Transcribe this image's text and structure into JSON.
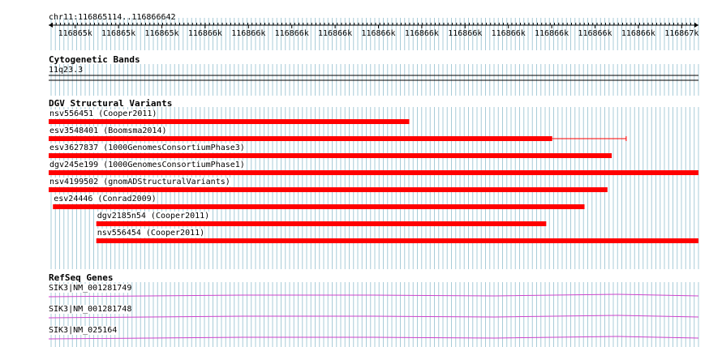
{
  "ruler": {
    "locus": "chr11:116865114..116866642",
    "tick_labels": [
      "116865k",
      "116865k",
      "116865k",
      "116866k",
      "116866k",
      "116866k",
      "116866k",
      "116866k",
      "116866k",
      "116866k",
      "116866k",
      "116866k",
      "116866k",
      "116866k",
      "116867k"
    ]
  },
  "tracks": {
    "cytoband": {
      "title": "Cytogenetic Bands",
      "band": "11q23.3"
    },
    "dgv": {
      "title": "DGV Structural Variants",
      "features": [
        {
          "label": "nsv556451 (Cooper2011)",
          "start": 116865114,
          "end": 116865962,
          "color": "#ff0000"
        },
        {
          "label": "esv3548401 (Boomsma2014)",
          "start": 116865114,
          "end": 116866298,
          "extends_to": 116866472,
          "color": "#ff0000"
        },
        {
          "label": "esv3627837 (1000GenomesConsortiumPhase3)",
          "start": 116865114,
          "end": 116866438,
          "color": "#ff0000"
        },
        {
          "label": "dgv245e199 (1000GenomesConsortiumPhase1)",
          "start": 116865114,
          "end": 116866642,
          "color": "#ff0000"
        },
        {
          "label": "nsv4199502 (gnomADStructuralVariants)",
          "start": 116865114,
          "end": 116866428,
          "color": "#ff0000"
        },
        {
          "label": "esv24446 (Conrad2009)",
          "start": 116865124,
          "end": 116866374,
          "color": "#ff0000"
        },
        {
          "label": "dgv2185n54 (Cooper2011)",
          "start": 116865226,
          "end": 116866284,
          "color": "#ff0000"
        },
        {
          "label": "nsv556454 (Cooper2011)",
          "start": 116865226,
          "end": 116866642,
          "color": "#ff0000"
        }
      ]
    },
    "refseq": {
      "title": "RefSeq Genes",
      "genes": [
        {
          "label": "SIK3|NM_001281749",
          "color": "#cc44cc"
        },
        {
          "label": "SIK3|NM_001281748",
          "color": "#cc44cc"
        },
        {
          "label": "SIK3|NM_025164",
          "color": "#cc44cc"
        }
      ]
    }
  },
  "colors": {
    "grid": "#a8ccd8",
    "feature": "#ff0000",
    "gene": "#cc44cc",
    "ruler": "#000000"
  }
}
